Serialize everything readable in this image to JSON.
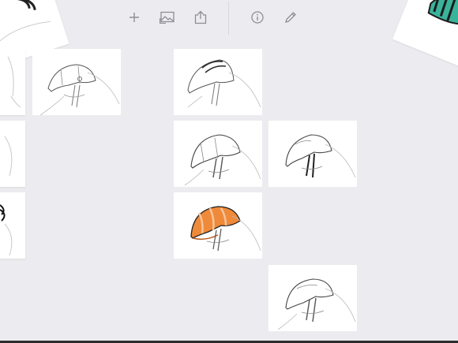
{
  "app": {
    "background_color": "#ececf0",
    "accent_color": "#ef8a3a"
  },
  "toolbar": {
    "buttons": [
      {
        "name": "add-button",
        "icon": "plus-icon"
      },
      {
        "name": "image-button",
        "icon": "image-icon"
      },
      {
        "name": "share-button",
        "icon": "share-icon"
      },
      {
        "name": "info-button",
        "icon": "info-icon"
      },
      {
        "name": "edit-button",
        "icon": "pencil-icon"
      }
    ],
    "icon_color": "#8d8d94"
  },
  "sketches": [
    {
      "name": "sketch-thumb-r1c1",
      "style": "pencil-helmet"
    },
    {
      "name": "sketch-thumb-r1c2",
      "style": "pencil-crest-helmet"
    },
    {
      "name": "sketch-thumb-r2c2",
      "style": "pencil-helmet"
    },
    {
      "name": "sketch-thumb-r2c3",
      "style": "pencil-helmet"
    },
    {
      "name": "sketch-thumb-r3c2",
      "style": "orange-colored-helmet"
    },
    {
      "name": "sketch-thumb-r4c3",
      "style": "pencil-helmet"
    }
  ]
}
